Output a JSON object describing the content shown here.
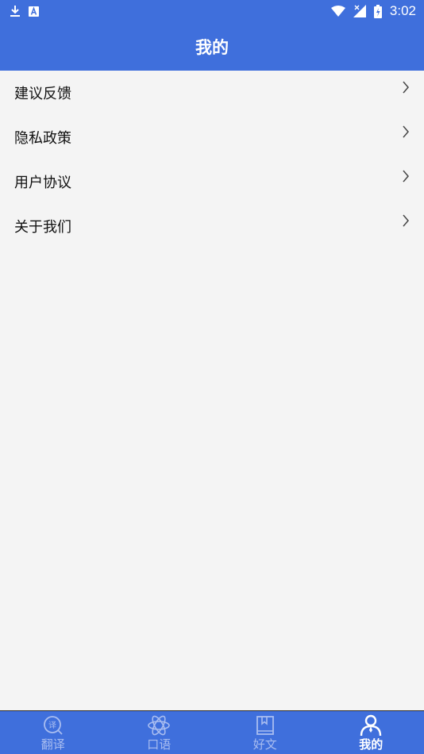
{
  "status_bar": {
    "time": "3:02",
    "icons": [
      "download-icon",
      "text-a-icon",
      "wifi-icon",
      "no-signal-icon",
      "battery-charging-icon"
    ]
  },
  "app_bar": {
    "title": "我的"
  },
  "menu": {
    "items": [
      {
        "label": "建议反馈",
        "icon": "chevron-right-icon"
      },
      {
        "label": "隐私政策",
        "icon": "chevron-right-icon"
      },
      {
        "label": "用户协议",
        "icon": "chevron-right-icon"
      },
      {
        "label": "关于我们",
        "icon": "chevron-right-icon"
      }
    ]
  },
  "bottom_nav": {
    "items": [
      {
        "label": "翻译",
        "icon": "translate-icon",
        "active": false
      },
      {
        "label": "口语",
        "icon": "atom-icon",
        "active": false
      },
      {
        "label": "好文",
        "icon": "bookmark-book-icon",
        "active": false
      },
      {
        "label": "我的",
        "icon": "profile-icon",
        "active": true
      }
    ]
  },
  "colors": {
    "brand_blue": "#3f6fdc",
    "page_bg": "#f4f4f4",
    "inactive_nav": "#a9bdf0",
    "active_nav": "#ffffff"
  }
}
